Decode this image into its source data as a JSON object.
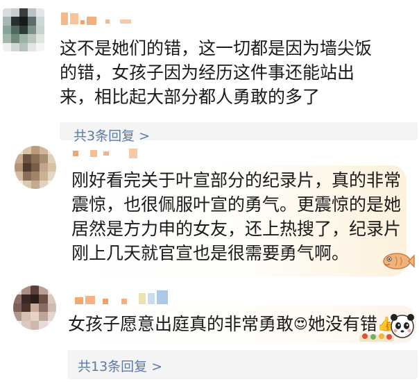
{
  "comments": [
    {
      "text": "这不是她们的错，这一切都是因为墙尖饭的错，女孩子因为经历这件事还能站出来，相比起大部分都人勇敢的多了",
      "reply_link": "共3条回复 >"
    },
    {
      "text": "刚好看完关于叶宣部分的纪录片，真的非常震惊，也很佩服叶宣的勇气。更震惊的是她居然是方力申的女友，还上热搜了，纪录片刚上几天就官宣也是很需要勇气啊。"
    },
    {
      "text_before": "女孩子愿意出庭真的非常勇敢",
      "text_after": "她没有错",
      "emoji_1": "😍",
      "emoji_2": "👍",
      "reply_link": "共13条回复 >"
    }
  ],
  "colors": {
    "link": "#5d7aa6",
    "text": "#1a1a1a",
    "reply_bg": "#f4f4f4",
    "bubble_accent": "#fdf1dc"
  }
}
